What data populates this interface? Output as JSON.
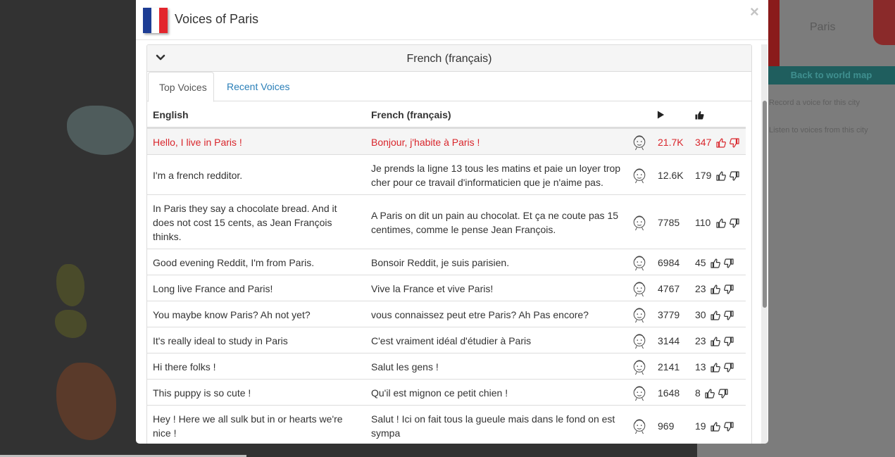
{
  "modal": {
    "title": "Voices of Paris",
    "close_glyph": "×",
    "flag_colors": [
      "#1d3d94",
      "#ffffff",
      "#e3262d"
    ]
  },
  "language_panel": {
    "title": "French (français)",
    "toggle_icon": "chevron-down-icon"
  },
  "tabs": [
    {
      "label": "Top Voices",
      "active": true
    },
    {
      "label": "Recent Voices",
      "active": false
    }
  ],
  "table": {
    "columns": {
      "english": "English",
      "french": "French (français)",
      "plays_icon": "play-icon",
      "votes_icon": "thumbs-up-icon"
    },
    "rows": [
      {
        "english": "Hello, I live in Paris !",
        "french": "Bonjour, j'habite à Paris !",
        "plays": "21.7K",
        "votes": "347"
      },
      {
        "english": "I'm a french redditor.",
        "french": "Je prends la ligne 13 tous les matins et paie un loyer trop cher pour ce travail d'informaticien que je n'aime pas.",
        "plays": "12.6K",
        "votes": "179"
      },
      {
        "english": "In Paris they say a chocolate bread. And it does not cost 15 cents, as Jean François thinks.",
        "french": "A Paris on dit un pain au chocolat. Et ça ne coute pas 15 centimes, comme le pense Jean François.",
        "plays": "7785",
        "votes": "110"
      },
      {
        "english": "Good evening Reddit, I'm from Paris.",
        "french": "Bonsoir Reddit, je suis parisien.",
        "plays": "6984",
        "votes": "45"
      },
      {
        "english": "Long live France and Paris!",
        "french": "Vive la France et vive Paris!",
        "plays": "4767",
        "votes": "23"
      },
      {
        "english": "You maybe know Paris? Ah not yet?",
        "french": "vous connaissez peut etre Paris? Ah Pas encore?",
        "plays": "3779",
        "votes": "30"
      },
      {
        "english": "It's really ideal to study in Paris",
        "french": "C'est vraiment idéal d'étudier à Paris",
        "plays": "3144",
        "votes": "23"
      },
      {
        "english": "Hi there folks !",
        "french": "Salut les gens !",
        "plays": "2141",
        "votes": "13"
      },
      {
        "english": "This puppy is so cute !",
        "french": "Qu'il est mignon ce petit chien !",
        "plays": "1648",
        "votes": "8"
      },
      {
        "english": "Hey ! Here we all sulk but in or hearts we're nice !",
        "french": "Salut ! Ici on fait tous la gueule mais dans le fond on est sympa",
        "plays": "969",
        "votes": "19"
      }
    ]
  },
  "background": {
    "city_label": "Paris",
    "back_button": "Back to world map",
    "links": [
      "Record a voice for this city",
      "Listen to voices from this city"
    ]
  },
  "colors": {
    "highlight_red": "#d9262c",
    "link_blue": "#2a7fb8"
  }
}
